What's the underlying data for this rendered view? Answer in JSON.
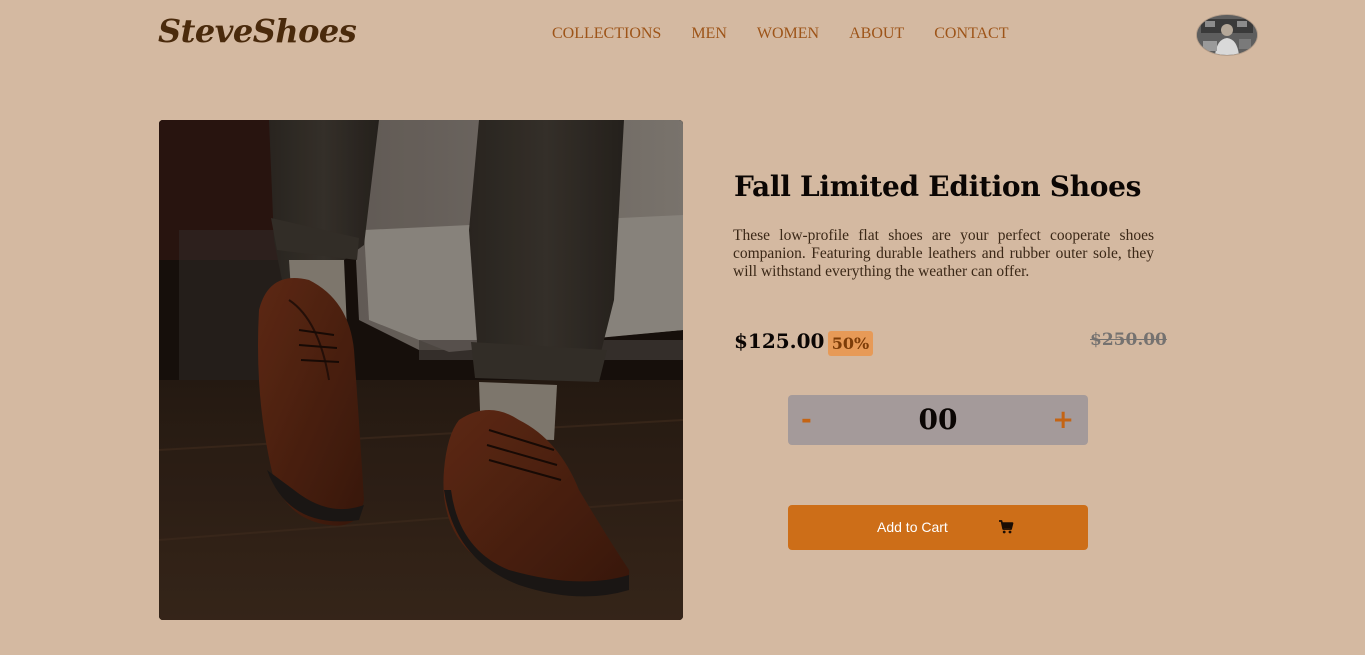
{
  "header": {
    "logo_text": "SteveShoes",
    "nav": [
      {
        "label": "COLLECTIONS"
      },
      {
        "label": "MEN"
      },
      {
        "label": "WOMEN"
      },
      {
        "label": "ABOUT"
      },
      {
        "label": "CONTACT"
      }
    ]
  },
  "product": {
    "title": "Fall Limited Edition Shoes",
    "description": "These low-profile flat shoes are your perfect cooperate shoes companion. Featuring durable leathers and rubber outer sole, they will withstand everything the weather can offer.",
    "price": "$125.00",
    "discount": "50%",
    "old_price": "$250.00",
    "quantity": {
      "minus": "-",
      "value": "00",
      "plus": "+"
    },
    "add_to_cart_label": "Add to Cart",
    "cart_icon": "cart-icon"
  },
  "colors": {
    "background": "#d4b9a1",
    "accent": "#cd6e18",
    "nav_text": "#9d5418",
    "badge": "#e79a57",
    "quantity_box": "#a49a9a"
  }
}
